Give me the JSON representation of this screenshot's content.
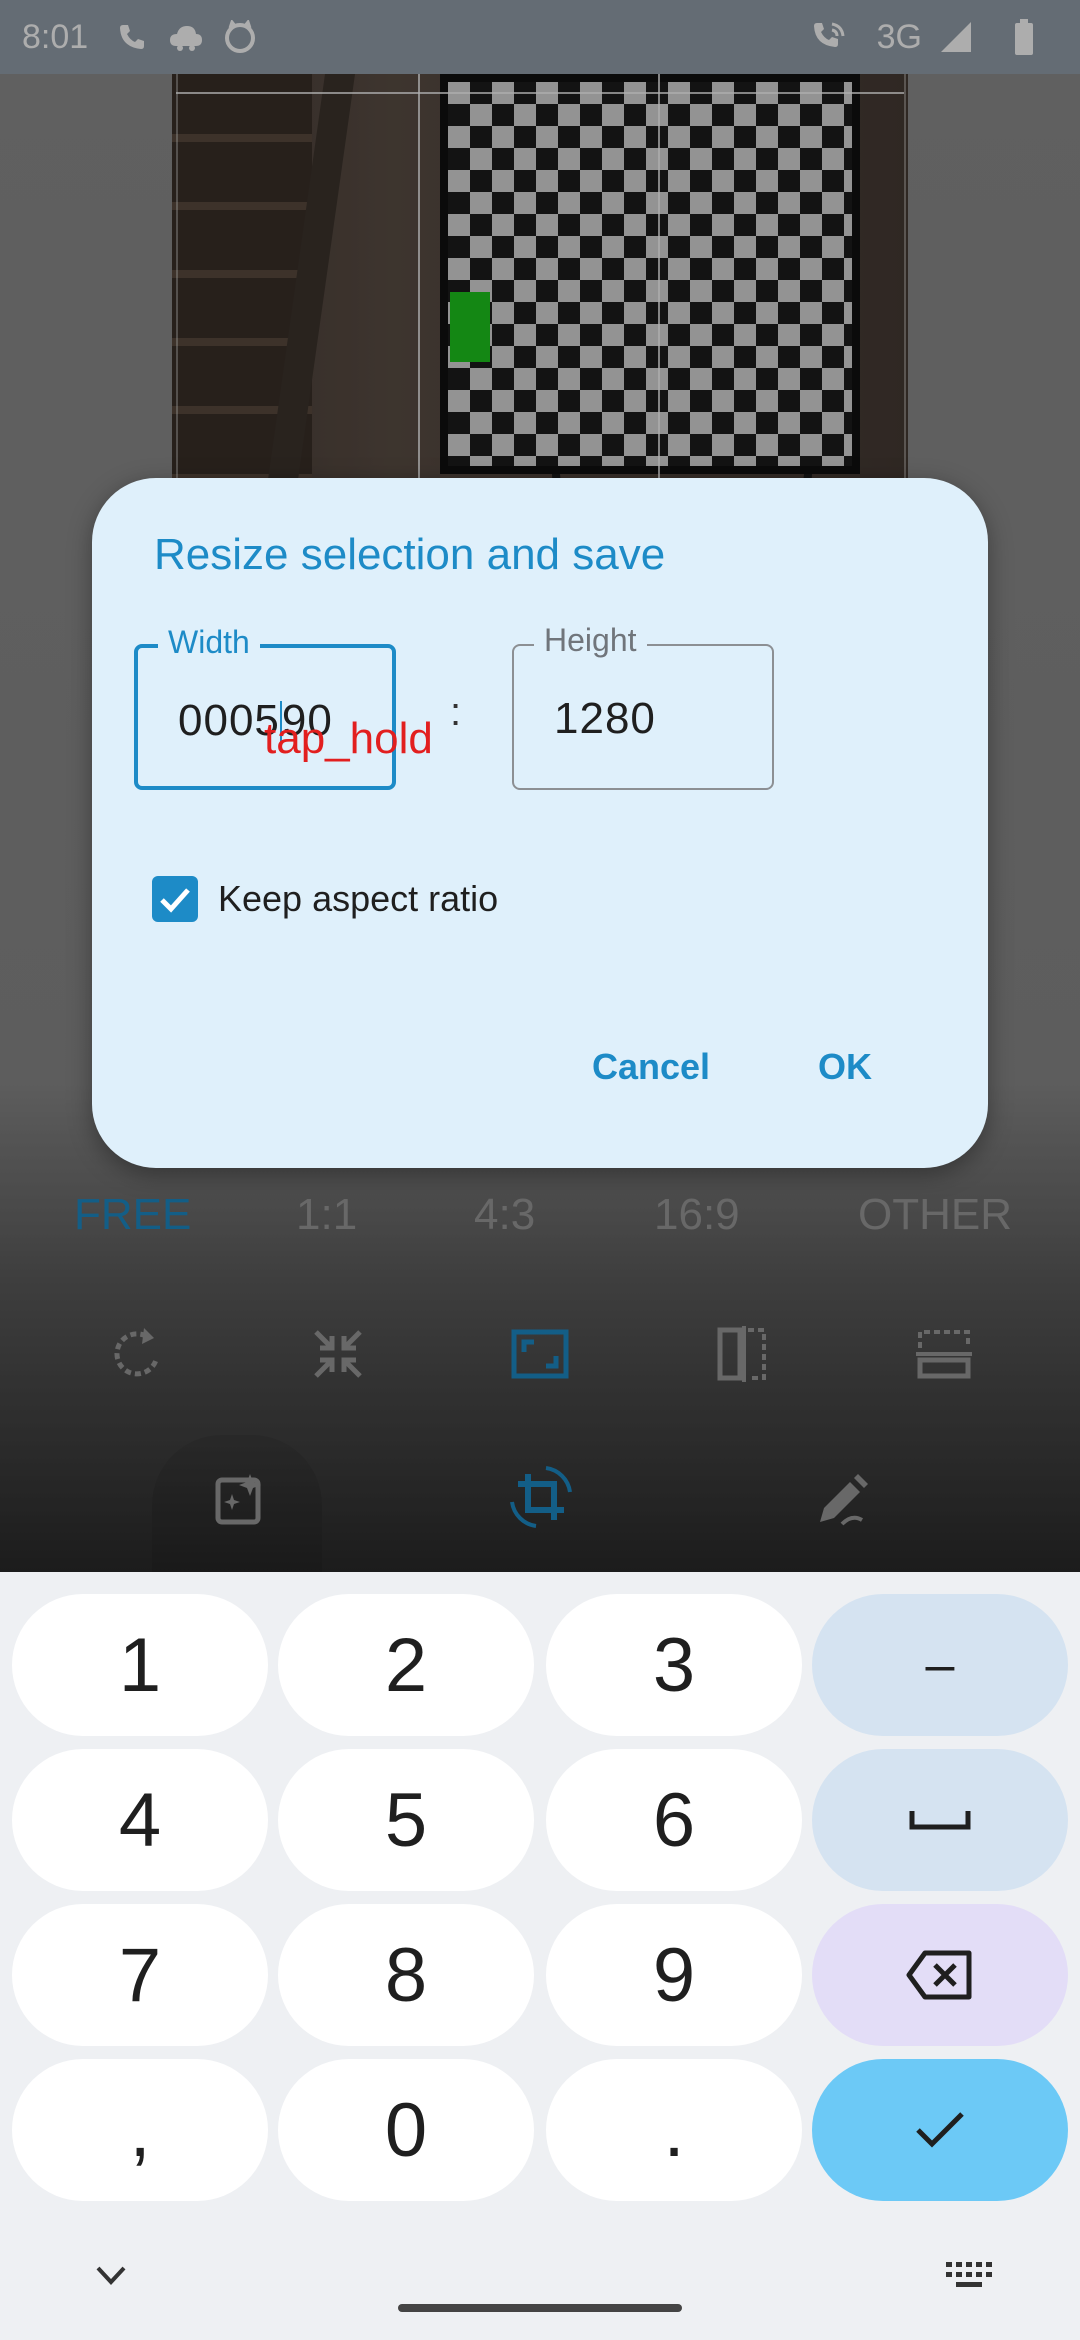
{
  "status_bar": {
    "time": "8:01",
    "network": "3G",
    "icons": [
      "phone-icon",
      "cloud-icon",
      "cat-icon",
      "wifi-calling-icon",
      "signal-icon",
      "battery-icon"
    ]
  },
  "editor": {
    "ratios": [
      "FREE",
      "1:1",
      "4:3",
      "16:9",
      "OTHER"
    ],
    "active_ratio": "FREE",
    "tools": [
      "rotate-icon",
      "resize-icon",
      "crop-frame-icon",
      "flip-horizontal-icon",
      "flip-vertical-icon"
    ],
    "modes": [
      "filter-icon",
      "crop-rotate-icon",
      "draw-icon"
    ]
  },
  "dialog": {
    "title": "Resize selection and save",
    "width_label": "Width",
    "width_value_before_caret": "0005",
    "width_value_after_caret": "90",
    "height_label": "Height",
    "height_value": "1280",
    "separator": ":",
    "keep_aspect_label": "Keep aspect ratio",
    "keep_aspect_checked": true,
    "cancel_label": "Cancel",
    "ok_label": "OK"
  },
  "overlay": {
    "action_label": "tap_hold"
  },
  "keyboard": {
    "keys": [
      {
        "label": "1",
        "type": "digit"
      },
      {
        "label": "2",
        "type": "digit"
      },
      {
        "label": "3",
        "type": "digit"
      },
      {
        "label": "–",
        "type": "fn"
      },
      {
        "label": "4",
        "type": "digit"
      },
      {
        "label": "5",
        "type": "digit"
      },
      {
        "label": "6",
        "type": "digit"
      },
      {
        "label": "",
        "type": "space"
      },
      {
        "label": "7",
        "type": "digit"
      },
      {
        "label": "8",
        "type": "digit"
      },
      {
        "label": "9",
        "type": "digit"
      },
      {
        "label": "",
        "type": "backspace"
      },
      {
        "label": ",",
        "type": "digit"
      },
      {
        "label": "0",
        "type": "digit"
      },
      {
        "label": ".",
        "type": "digit"
      },
      {
        "label": "",
        "type": "enter"
      }
    ]
  },
  "colors": {
    "accent": "#1d8bc7",
    "dialog_bg": "#dff0fb",
    "tap_hold": "#e21f1f",
    "enter_key": "#6cc9f6"
  }
}
